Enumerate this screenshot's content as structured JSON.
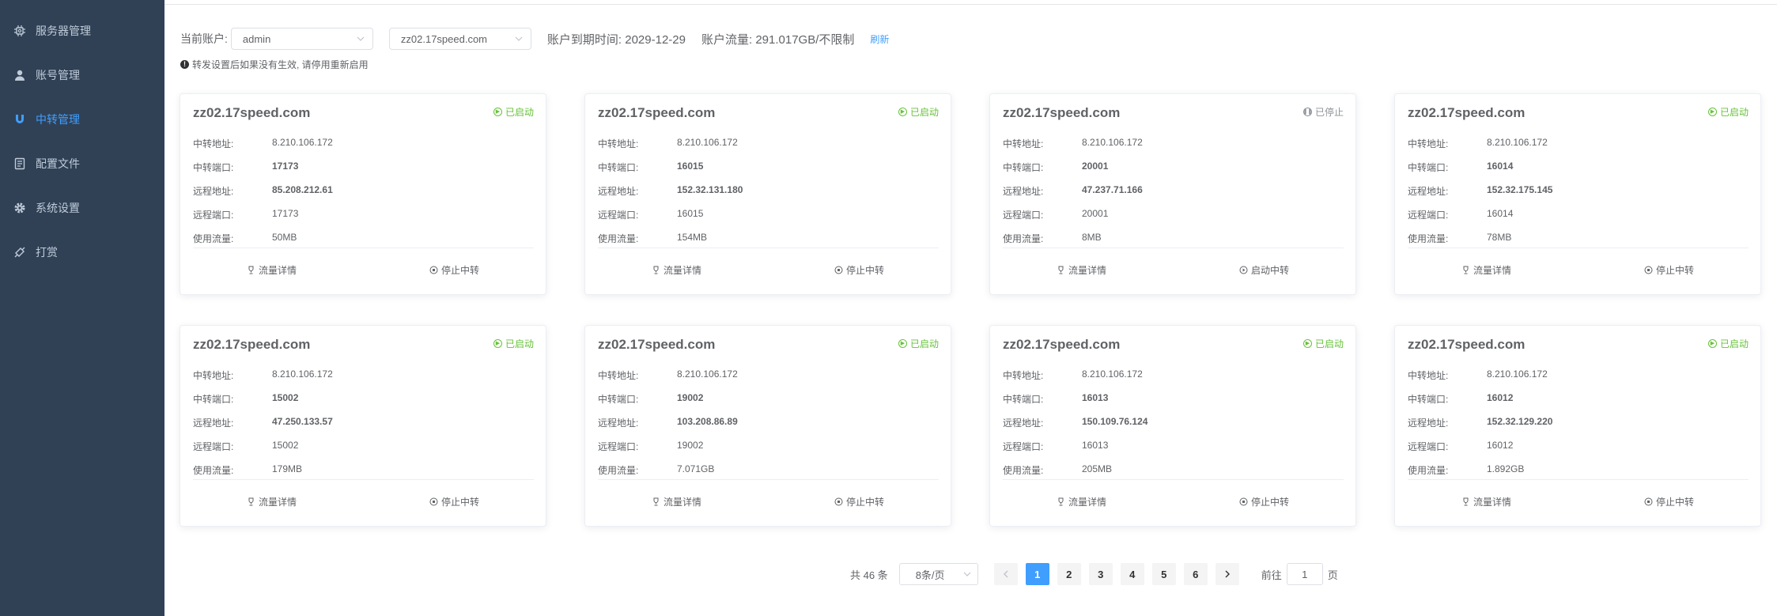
{
  "sidebar": {
    "items": [
      {
        "label": "服务器管理",
        "icon": "chip-icon",
        "active": false
      },
      {
        "label": "账号管理",
        "icon": "user-icon",
        "active": false
      },
      {
        "label": "中转管理",
        "icon": "magnet-icon",
        "active": true
      },
      {
        "label": "配置文件",
        "icon": "document-icon",
        "active": false
      },
      {
        "label": "系统设置",
        "icon": "gear-icon",
        "active": false
      },
      {
        "label": "打赏",
        "icon": "link-icon",
        "active": false
      }
    ]
  },
  "toolbar": {
    "account_label": "当前账户:",
    "account_value": "admin",
    "server_value": "zz02.17speed.com",
    "expire_label": "账户到期时间:",
    "expire_value": "2029-12-29",
    "traffic_label": "账户流量:",
    "traffic_value": "291.017GB/不限制",
    "refresh_label": "刷新",
    "notice": "转发设置后如果没有生效, 请停用重新启用"
  },
  "cards": [
    {
      "title": "zz02.17speed.com",
      "status": "已启动",
      "running": true,
      "relay_addr": "8.210.106.172",
      "relay_port": "17173",
      "remote_addr": "85.208.212.61",
      "remote_port": "17173",
      "traffic": "50MB",
      "detail_label": "流量详情",
      "toggle_label": "停止中转"
    },
    {
      "title": "zz02.17speed.com",
      "status": "已启动",
      "running": true,
      "relay_addr": "8.210.106.172",
      "relay_port": "16015",
      "remote_addr": "152.32.131.180",
      "remote_port": "16015",
      "traffic": "154MB",
      "detail_label": "流量详情",
      "toggle_label": "停止中转"
    },
    {
      "title": "zz02.17speed.com",
      "status": "已停止",
      "running": false,
      "relay_addr": "8.210.106.172",
      "relay_port": "20001",
      "remote_addr": "47.237.71.166",
      "remote_port": "20001",
      "traffic": "8MB",
      "detail_label": "流量详情",
      "toggle_label": "启动中转"
    },
    {
      "title": "zz02.17speed.com",
      "status": "已启动",
      "running": true,
      "relay_addr": "8.210.106.172",
      "relay_port": "16014",
      "remote_addr": "152.32.175.145",
      "remote_port": "16014",
      "traffic": "78MB",
      "detail_label": "流量详情",
      "toggle_label": "停止中转"
    },
    {
      "title": "zz02.17speed.com",
      "status": "已启动",
      "running": true,
      "relay_addr": "8.210.106.172",
      "relay_port": "15002",
      "remote_addr": "47.250.133.57",
      "remote_port": "15002",
      "traffic": "179MB",
      "detail_label": "流量详情",
      "toggle_label": "停止中转"
    },
    {
      "title": "zz02.17speed.com",
      "status": "已启动",
      "running": true,
      "relay_addr": "8.210.106.172",
      "relay_port": "19002",
      "remote_addr": "103.208.86.89",
      "remote_port": "19002",
      "traffic": "7.071GB",
      "detail_label": "流量详情",
      "toggle_label": "停止中转"
    },
    {
      "title": "zz02.17speed.com",
      "status": "已启动",
      "running": true,
      "relay_addr": "8.210.106.172",
      "relay_port": "16013",
      "remote_addr": "150.109.76.124",
      "remote_port": "16013",
      "traffic": "205MB",
      "detail_label": "流量详情",
      "toggle_label": "停止中转"
    },
    {
      "title": "zz02.17speed.com",
      "status": "已启动",
      "running": true,
      "relay_addr": "8.210.106.172",
      "relay_port": "16012",
      "remote_addr": "152.32.129.220",
      "remote_port": "16012",
      "traffic": "1.892GB",
      "detail_label": "流量详情",
      "toggle_label": "停止中转"
    }
  ],
  "field_labels": {
    "relay_addr": "中转地址:",
    "relay_port": "中转端口:",
    "remote_addr": "远程地址:",
    "remote_port": "远程端口:",
    "traffic": "使用流量:"
  },
  "pagination": {
    "total": "共 46 条",
    "page_size": "8条/页",
    "pages": [
      "1",
      "2",
      "3",
      "4",
      "5",
      "6"
    ],
    "current": "1",
    "goto_prefix": "前往",
    "goto_value": "1",
    "goto_suffix": "页"
  },
  "colors": {
    "sidebar_bg": "#304156",
    "accent": "#409eff",
    "running": "#67c23a",
    "stopped": "#909399"
  }
}
